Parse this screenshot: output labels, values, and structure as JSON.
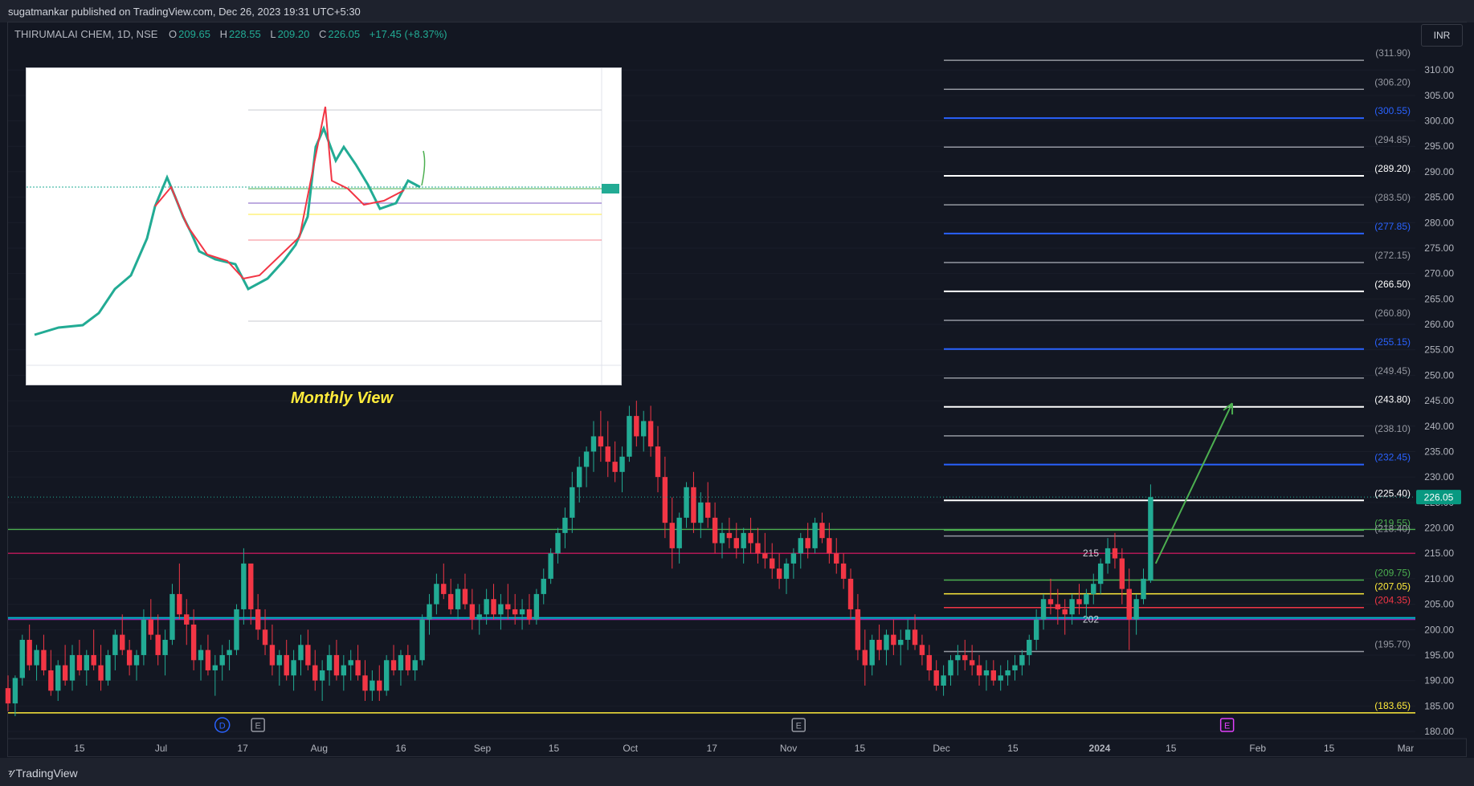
{
  "header": {
    "publish_line": "sugatmankar published on TradingView.com, Dec 26, 2023 19:31 UTC+5:30"
  },
  "symbol": {
    "name": "THIRUMALAI CHEM, 1D, NSE",
    "o_label": "O",
    "o": "209.65",
    "h_label": "H",
    "h": "228.55",
    "l_label": "L",
    "l": "209.20",
    "c_label": "C",
    "c": "226.05",
    "change": "+17.45 (+8.37%)"
  },
  "currency": "INR",
  "inset": {
    "caption": "Monthly View"
  },
  "footer": {
    "brand": "TradingView"
  },
  "colors": {
    "bg": "#131722",
    "up": "#22ab94",
    "down": "#f23645",
    "grid": "#1e222d",
    "green": "#4caf50",
    "yellow": "#ffeb3b",
    "blue": "#2962ff",
    "magenta": "#c2185b",
    "cyan": "#00bcd4",
    "purple": "#9c27b0",
    "red": "#f23645",
    "white": "#ffffff",
    "gray": "#9598a1",
    "accent_label": "#089981"
  },
  "chart_data": {
    "type": "candlestick",
    "symbol": "THIRUMALAI CHEM",
    "interval": "1D",
    "exchange": "NSE",
    "y_axis": {
      "min": 180,
      "max": 310,
      "step": 5,
      "ticks": [
        "180.00",
        "185.00",
        "190.00",
        "195.00",
        "200.00",
        "205.00",
        "210.00",
        "215.00",
        "220.00",
        "225.00",
        "230.00",
        "235.00",
        "240.00",
        "245.00",
        "250.00",
        "255.00",
        "260.00",
        "265.00",
        "270.00",
        "275.00",
        "280.00",
        "285.00",
        "290.00",
        "295.00",
        "300.00",
        "305.00",
        "310.00"
      ],
      "last_price": "226.05",
      "last_price_value": 226.05
    },
    "x_axis": {
      "ticks": [
        {
          "label": "15",
          "d": 14
        },
        {
          "label": "Jul",
          "d": 30
        },
        {
          "label": "17",
          "d": 46
        },
        {
          "label": "Aug",
          "d": 61
        },
        {
          "label": "16",
          "d": 77
        },
        {
          "label": "Sep",
          "d": 93
        },
        {
          "label": "15",
          "d": 107
        },
        {
          "label": "Oct",
          "d": 122
        },
        {
          "label": "17",
          "d": 138
        },
        {
          "label": "Nov",
          "d": 153
        },
        {
          "label": "15",
          "d": 167
        },
        {
          "label": "Dec",
          "d": 183
        },
        {
          "label": "15",
          "d": 197
        },
        {
          "label": "2024",
          "d": 214
        },
        {
          "label": "15",
          "d": 228
        },
        {
          "label": "Feb",
          "d": 245
        },
        {
          "label": "15",
          "d": 259
        },
        {
          "label": "Mar",
          "d": 274
        }
      ]
    },
    "events": [
      {
        "label": "D",
        "d": 42,
        "color": "#2962ff"
      },
      {
        "label": "E",
        "d": 49,
        "color": "#9598a1"
      },
      {
        "label": "E",
        "d": 155,
        "color": "#9598a1"
      },
      {
        "label": "E",
        "d": 239,
        "color": "#e040fb"
      }
    ],
    "fib_levels": [
      {
        "value": 311.9,
        "label": "(311.90)",
        "color": "#9598a1"
      },
      {
        "value": 306.2,
        "label": "(306.20)",
        "color": "#9598a1"
      },
      {
        "value": 300.55,
        "label": "(300.55)",
        "color": "#2962ff"
      },
      {
        "value": 294.85,
        "label": "(294.85)",
        "color": "#9598a1"
      },
      {
        "value": 289.2,
        "label": "(289.20)",
        "color": "#ffffff"
      },
      {
        "value": 283.5,
        "label": "(283.50)",
        "color": "#9598a1"
      },
      {
        "value": 277.85,
        "label": "(277.85)",
        "color": "#2962ff"
      },
      {
        "value": 272.15,
        "label": "(272.15)",
        "color": "#9598a1"
      },
      {
        "value": 266.5,
        "label": "(266.50)",
        "color": "#ffffff"
      },
      {
        "value": 260.8,
        "label": "(260.80)",
        "color": "#9598a1"
      },
      {
        "value": 255.15,
        "label": "(255.15)",
        "color": "#2962ff"
      },
      {
        "value": 249.45,
        "label": "(249.45)",
        "color": "#9598a1"
      },
      {
        "value": 243.8,
        "label": "(243.80)",
        "color": "#ffffff"
      },
      {
        "value": 238.1,
        "label": "(238.10)",
        "color": "#9598a1"
      },
      {
        "value": 232.45,
        "label": "(232.45)",
        "color": "#2962ff"
      },
      {
        "value": 225.4,
        "label": "(225.40)",
        "color": "#ffffff"
      },
      {
        "value": 219.55,
        "label": "(219.55)",
        "color": "#4caf50"
      },
      {
        "value": 218.4,
        "label": "(218.40)",
        "color": "#9598a1"
      },
      {
        "value": 209.75,
        "label": "(209.75)",
        "color": "#4caf50"
      },
      {
        "value": 207.05,
        "label": "(207.05)",
        "color": "#ffeb3b"
      },
      {
        "value": 204.35,
        "label": "(204.35)",
        "color": "#f23645"
      },
      {
        "value": 195.7,
        "label": "(195.70)",
        "color": "#9598a1"
      },
      {
        "value": 183.65,
        "label": "(183.65)",
        "color": "#ffeb3b"
      }
    ],
    "horizontal_lines": [
      {
        "value": 219.7,
        "color": "#4caf50",
        "label": ""
      },
      {
        "value": 215,
        "color": "#c2185b",
        "label": "215"
      },
      {
        "value": 202.3,
        "color": "#00bcd4",
        "label": ""
      },
      {
        "value": 202,
        "color": "#9c27b0",
        "label": "202"
      },
      {
        "value": 183.65,
        "color": "#ffeb3b",
        "label": ""
      }
    ],
    "arrow": {
      "from_d": 225,
      "from_v": 213,
      "to_d": 240,
      "to_v": 244.5,
      "color": "#4caf50"
    },
    "ohlc": [
      [
        188.5,
        191,
        184,
        185.5
      ],
      [
        185.5,
        191,
        183,
        190.5
      ],
      [
        190.5,
        199,
        189,
        198
      ],
      [
        198,
        201,
        192,
        193
      ],
      [
        193,
        197,
        190,
        196
      ],
      [
        196,
        199,
        191,
        192
      ],
      [
        192,
        196,
        187,
        188
      ],
      [
        188,
        194,
        186,
        193
      ],
      [
        193,
        197,
        189,
        190
      ],
      [
        190,
        197,
        188,
        195
      ],
      [
        195,
        198,
        191,
        192
      ],
      [
        192,
        196,
        189,
        195
      ],
      [
        195,
        200,
        192,
        193
      ],
      [
        193,
        197,
        188,
        190
      ],
      [
        190,
        196,
        189,
        195
      ],
      [
        195,
        200,
        192,
        199
      ],
      [
        199,
        203,
        195,
        196
      ],
      [
        196,
        198,
        191,
        193
      ],
      [
        193,
        196,
        190,
        195
      ],
      [
        195,
        204,
        193,
        202
      ],
      [
        202,
        206,
        198,
        199
      ],
      [
        199,
        203,
        193,
        195
      ],
      [
        195,
        200,
        191,
        198
      ],
      [
        198,
        209,
        197,
        207
      ],
      [
        207,
        213,
        202,
        203
      ],
      [
        203,
        206,
        197,
        201
      ],
      [
        201,
        204,
        192,
        194
      ],
      [
        194,
        197,
        190,
        196
      ],
      [
        196,
        199,
        191,
        192
      ],
      [
        192,
        195,
        187,
        193
      ],
      [
        193,
        197,
        190,
        195
      ],
      [
        195,
        198,
        192,
        196
      ],
      [
        196,
        205,
        195,
        204
      ],
      [
        204,
        216,
        201,
        213
      ],
      [
        213,
        208,
        201,
        204
      ],
      [
        204,
        207,
        198,
        200
      ],
      [
        200,
        204,
        195,
        197
      ],
      [
        197,
        201,
        191,
        193
      ],
      [
        193,
        196,
        189,
        195
      ],
      [
        195,
        198,
        190,
        191
      ],
      [
        191,
        196,
        188,
        194
      ],
      [
        194,
        199,
        191,
        197
      ],
      [
        197,
        200,
        192,
        193
      ],
      [
        193,
        196,
        188,
        190
      ],
      [
        190,
        194,
        186,
        192
      ],
      [
        192,
        197,
        189,
        195
      ],
      [
        195,
        198,
        190,
        191
      ],
      [
        191,
        195,
        188,
        193
      ],
      [
        193,
        196,
        190,
        194
      ],
      [
        194,
        197,
        190,
        191
      ],
      [
        191,
        194,
        186,
        188
      ],
      [
        188,
        192,
        186,
        190
      ],
      [
        190,
        193,
        186,
        188
      ],
      [
        188,
        195,
        187,
        194
      ],
      [
        194,
        197,
        191,
        192
      ],
      [
        192,
        196,
        189,
        195
      ],
      [
        195,
        197,
        191,
        192
      ],
      [
        192,
        195,
        190,
        194
      ],
      [
        194,
        203,
        193,
        202
      ],
      [
        202,
        207,
        199,
        205
      ],
      [
        205,
        211,
        203,
        209
      ],
      [
        209,
        213,
        206,
        207
      ],
      [
        207,
        210,
        203,
        204
      ],
      [
        204,
        209,
        202,
        208
      ],
      [
        208,
        211,
        204,
        205
      ],
      [
        205,
        208,
        200,
        202
      ],
      [
        202,
        205,
        199,
        203
      ],
      [
        203,
        208,
        201,
        206
      ],
      [
        206,
        209,
        202,
        203
      ],
      [
        203,
        207,
        200,
        205
      ],
      [
        205,
        209,
        202,
        204
      ],
      [
        204,
        207,
        201,
        203
      ],
      [
        203,
        206,
        200,
        204
      ],
      [
        204,
        207,
        201,
        202
      ],
      [
        202,
        208,
        201,
        207
      ],
      [
        207,
        212,
        205,
        210
      ],
      [
        210,
        216,
        209,
        215
      ],
      [
        215,
        220,
        213,
        219
      ],
      [
        219,
        224,
        216,
        222
      ],
      [
        222,
        231,
        219,
        228
      ],
      [
        228,
        234,
        225,
        232
      ],
      [
        232,
        236,
        228,
        235
      ],
      [
        235,
        241,
        231,
        238
      ],
      [
        238,
        243,
        233,
        236
      ],
      [
        236,
        241,
        230,
        233
      ],
      [
        233,
        237,
        229,
        231
      ],
      [
        231,
        236,
        227,
        234
      ],
      [
        234,
        244,
        233,
        242
      ],
      [
        242,
        245,
        236,
        238
      ],
      [
        238,
        243,
        235,
        241
      ],
      [
        241,
        244,
        234,
        236
      ],
      [
        236,
        240,
        227,
        230
      ],
      [
        230,
        234,
        218,
        221
      ],
      [
        221,
        226,
        212,
        216
      ],
      [
        216,
        223,
        213,
        222
      ],
      [
        222,
        229,
        220,
        228
      ],
      [
        228,
        231,
        219,
        221
      ],
      [
        221,
        227,
        218,
        225
      ],
      [
        225,
        229,
        220,
        222
      ],
      [
        222,
        225,
        215,
        217
      ],
      [
        217,
        221,
        214,
        219
      ],
      [
        219,
        222,
        216,
        218
      ],
      [
        218,
        221,
        214,
        216
      ],
      [
        216,
        220,
        213,
        219
      ],
      [
        219,
        222,
        215,
        217
      ],
      [
        217,
        220,
        213,
        215
      ],
      [
        215,
        219,
        212,
        214
      ],
      [
        214,
        217,
        210,
        212
      ],
      [
        212,
        215,
        208,
        210
      ],
      [
        210,
        214,
        207,
        213
      ],
      [
        213,
        216,
        210,
        215
      ],
      [
        215,
        219,
        212,
        218
      ],
      [
        218,
        221,
        214,
        216
      ],
      [
        216,
        222,
        215,
        221
      ],
      [
        221,
        223,
        217,
        218
      ],
      [
        218,
        221,
        213,
        215
      ],
      [
        215,
        218,
        211,
        213
      ],
      [
        213,
        215,
        208,
        210
      ],
      [
        210,
        212,
        202,
        204
      ],
      [
        204,
        207,
        194,
        196
      ],
      [
        196,
        200,
        189,
        193
      ],
      [
        193,
        199,
        191,
        198
      ],
      [
        198,
        201,
        194,
        196
      ],
      [
        196,
        200,
        193,
        199
      ],
      [
        199,
        202,
        195,
        197
      ],
      [
        197,
        200,
        193,
        198
      ],
      [
        198,
        202,
        196,
        200
      ],
      [
        200,
        203,
        196,
        197
      ],
      [
        197,
        199,
        193,
        195
      ],
      [
        195,
        197,
        190,
        192
      ],
      [
        192,
        194,
        188,
        189
      ],
      [
        189,
        193,
        187,
        191
      ],
      [
        191,
        195,
        189,
        194
      ],
      [
        194,
        197,
        191,
        195
      ],
      [
        195,
        198,
        192,
        194
      ],
      [
        194,
        197,
        191,
        193
      ],
      [
        193,
        195,
        189,
        191
      ],
      [
        191,
        194,
        188,
        192
      ],
      [
        192,
        194,
        189,
        190
      ],
      [
        190,
        193,
        188,
        191
      ],
      [
        191,
        194,
        189,
        192
      ],
      [
        192,
        195,
        190,
        193
      ],
      [
        193,
        196,
        191,
        195
      ],
      [
        195,
        199,
        193,
        198
      ],
      [
        198,
        204,
        196,
        202
      ],
      [
        202,
        207,
        200,
        206
      ],
      [
        206,
        210,
        203,
        205
      ],
      [
        205,
        208,
        201,
        204
      ],
      [
        204,
        206,
        199,
        203
      ],
      [
        203,
        207,
        201,
        206
      ],
      [
        206,
        209,
        203,
        205
      ],
      [
        205,
        208,
        202,
        207
      ],
      [
        207,
        211,
        205,
        209
      ],
      [
        209,
        214,
        207,
        213
      ],
      [
        213,
        218,
        211,
        216
      ],
      [
        216,
        219,
        212,
        214
      ],
      [
        214,
        216,
        205,
        208
      ],
      [
        208,
        212,
        196,
        202
      ],
      [
        202,
        207,
        199,
        206
      ],
      [
        206,
        212,
        205,
        210
      ],
      [
        209.65,
        228.55,
        209.2,
        226.05
      ]
    ],
    "ohlc_start_d": 0,
    "ohlc_step_d": 1.4
  }
}
